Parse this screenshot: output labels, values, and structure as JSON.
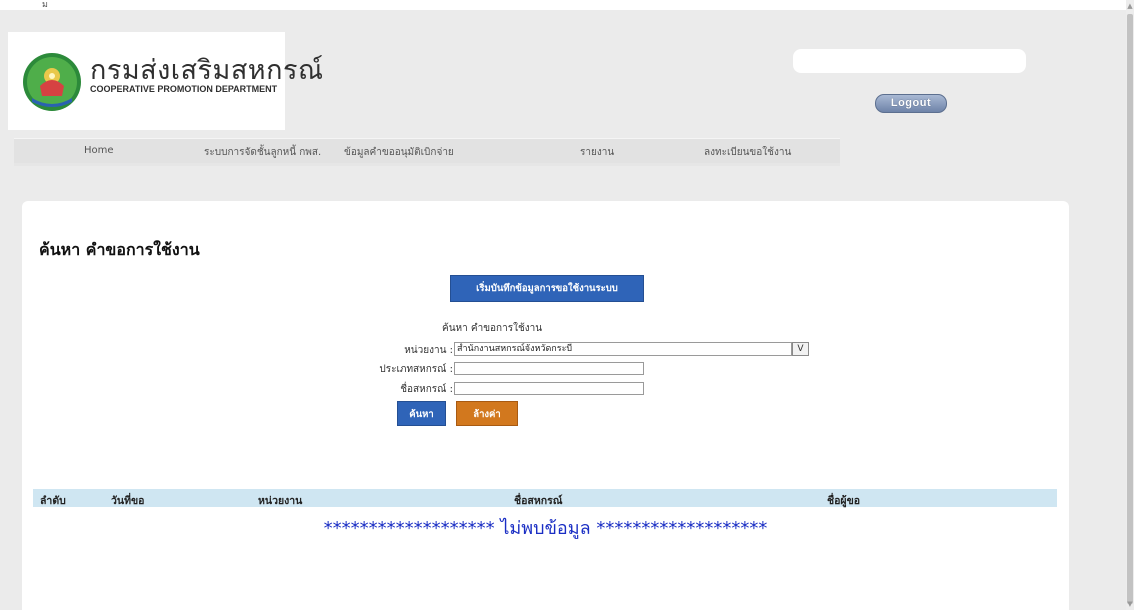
{
  "window": {
    "corner_mark": "ม"
  },
  "header": {
    "org_name_th": "กรมส่งเสริมสหกรณ์",
    "org_name_en": "COOPERATIVE PROMOTION DEPARTMENT",
    "user_label": "",
    "logout_label": "Logout"
  },
  "nav": {
    "items": [
      {
        "label": "Home"
      },
      {
        "label": "ระบบการจัดชั้นลูกหนี้ กพส."
      },
      {
        "label": "ข้อมูลคำขออนุมัติเบิกจ่าย"
      },
      {
        "label": "รายงาน"
      },
      {
        "label": "ลงทะเบียนขอใช้งาน"
      }
    ]
  },
  "main": {
    "title": "ค้นหา คำขอการใช้งาน",
    "start_button": "เริ่มบันทึกข้อมูลการขอใช้งานระบบ",
    "form": {
      "caption": "ค้นหา คำขอการใช้งาน",
      "unit_label": "หน่วยงาน :",
      "unit_value": "สำนักงานสหกรณ์จังหวัดกระบี่",
      "dropdown_glyph": "V",
      "coop_type_label": "ประเภทสหกรณ์ :",
      "coop_type_value": "",
      "coop_name_label": "ชื่อสหกรณ์ :",
      "coop_name_value": "",
      "search_button": "ค้นหา",
      "clear_button": "ล้างค่า"
    },
    "table": {
      "columns": [
        "ลำดับ",
        "วันที่ขอ",
        "หน่วยงาน",
        "ชื่อสหกรณ์",
        "ชื่อผู้ขอ"
      ],
      "rows": [],
      "empty_message": "******************* ไม่พบข้อมูล *******************"
    }
  },
  "colors": {
    "primary_button": "#2f64b8",
    "clear_button": "#d2781e",
    "table_header": "#cfe6f2",
    "empty_text": "#1a2ec4"
  }
}
